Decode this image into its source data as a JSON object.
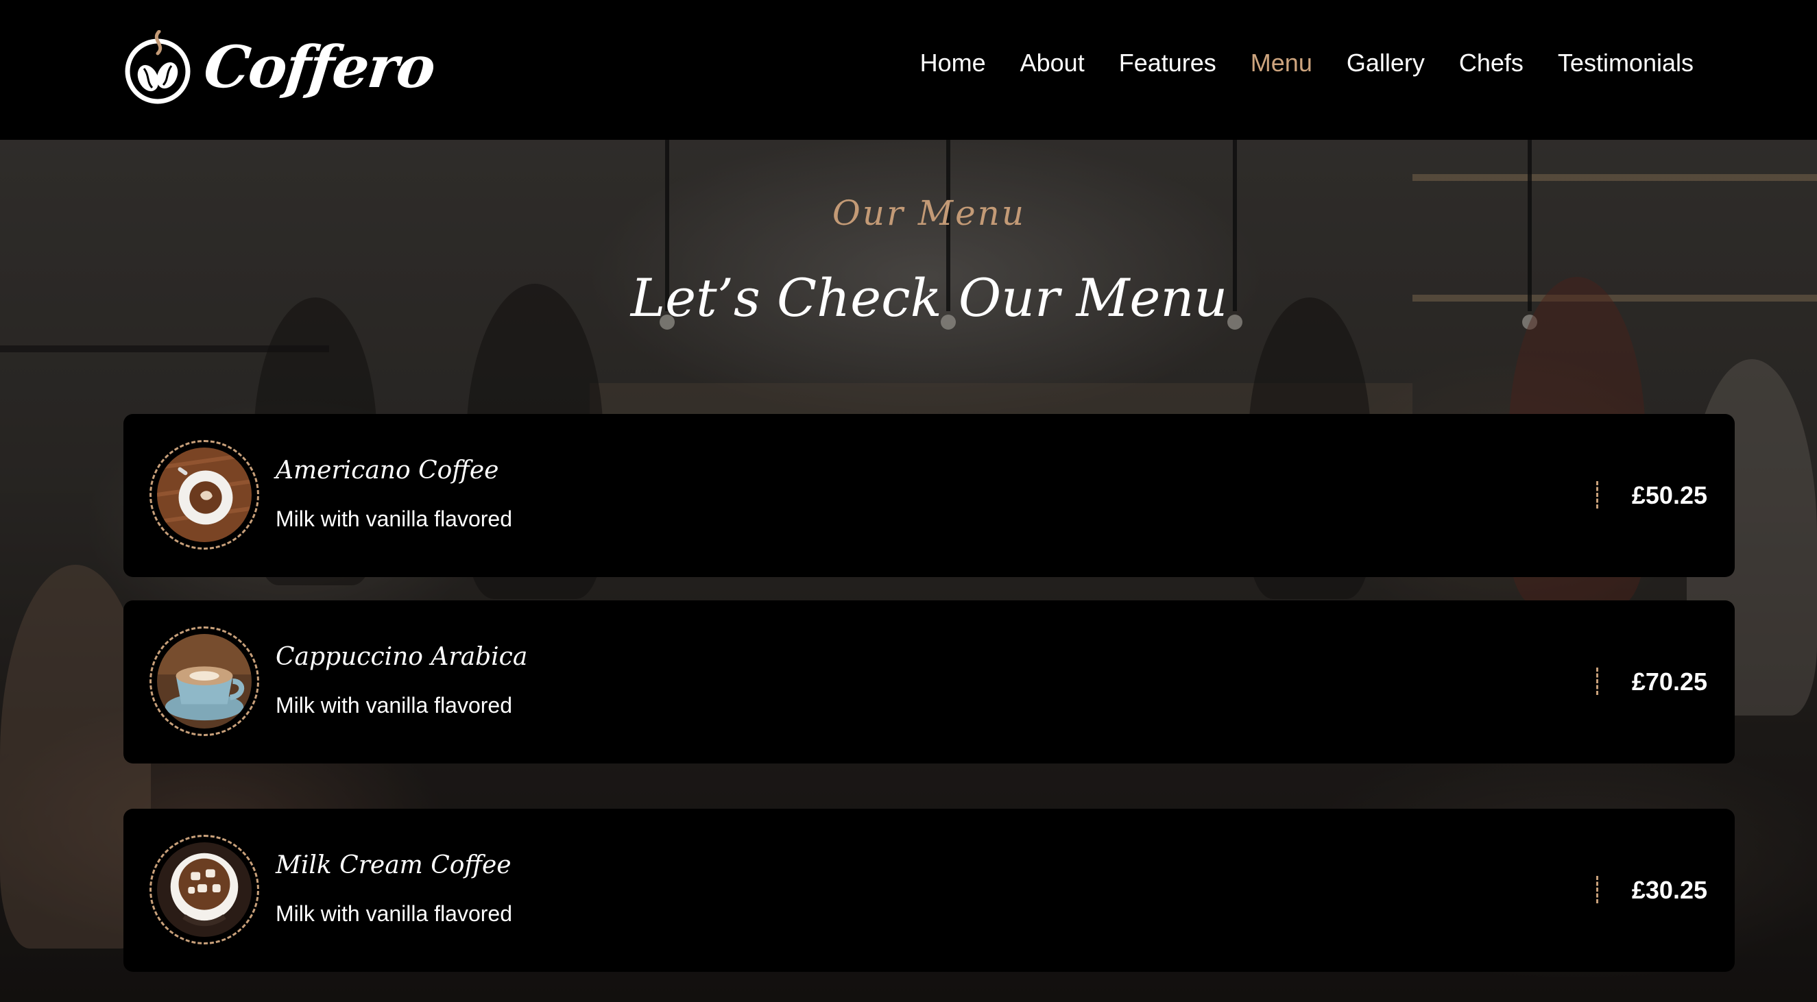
{
  "brand": {
    "name": "Coffero",
    "accent_color": "#cda47e",
    "logo_icon": "coffee-beans-steam-icon"
  },
  "nav": {
    "items": [
      {
        "label": "Home",
        "active": false
      },
      {
        "label": "About",
        "active": false
      },
      {
        "label": "Features",
        "active": false
      },
      {
        "label": "Menu",
        "active": true
      },
      {
        "label": "Gallery",
        "active": false
      },
      {
        "label": "Chefs",
        "active": false
      },
      {
        "label": "Testimonials",
        "active": false
      }
    ]
  },
  "menu_section": {
    "subtitle": "Our Menu",
    "title": "Let’s Check Our Menu",
    "items": [
      {
        "name": "Americano Coffee",
        "description": "Milk with vanilla flavored",
        "price": "£50.25",
        "image_icon": "americano-cup-icon"
      },
      {
        "name": "Cappuccino Arabica",
        "description": "Milk with vanilla flavored",
        "price": "£70.25",
        "image_icon": "cappuccino-cup-icon"
      },
      {
        "name": "Milk Cream Coffee",
        "description": "Milk with vanilla flavored",
        "price": "£30.25",
        "image_icon": "milk-cream-cup-icon"
      }
    ]
  }
}
